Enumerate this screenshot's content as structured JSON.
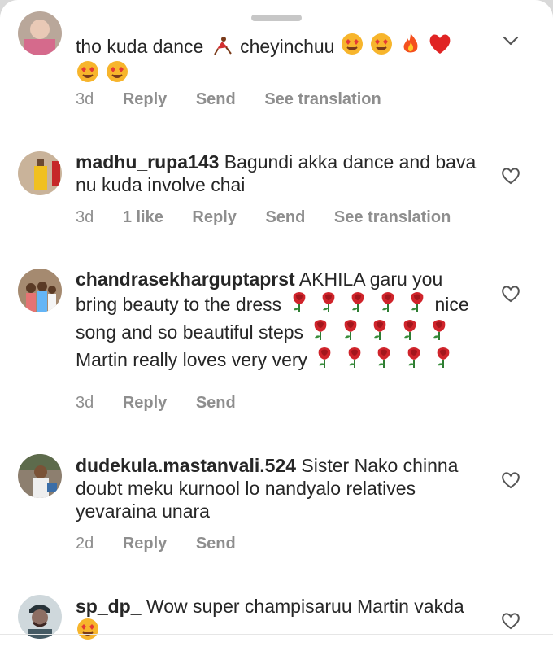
{
  "comments": [
    {
      "text_lines": [
        "tho kuda dance",
        "cheyinchuu"
      ],
      "time": "3d",
      "reply": "Reply",
      "send": "Send",
      "translate": "See translation"
    },
    {
      "username": "madhu_rupa143",
      "text": " Bagundi akka dance and bava nu kuda involve chai",
      "time": "3d",
      "likes": "1 like",
      "reply": "Reply",
      "send": "Send",
      "translate": "See translation"
    },
    {
      "username": "chandrasekharguptaprst",
      "text_parts": [
        " AKHILA garu you bring beauty to the dress ",
        "nice song and so beautiful steps",
        "Martin really loves very very"
      ],
      "time": "3d",
      "reply": "Reply",
      "send": "Send"
    },
    {
      "username": "dudekula.mastanvali.524",
      "text": " Sister Nako chinna doubt meku kurnool lo nandyalo relatives yevaraina unara",
      "time": "2d",
      "reply": "Reply",
      "send": "Send"
    },
    {
      "username": "sp_dp_",
      "text_parts": [
        " Wow super  champisaruu Martin vakda"
      ]
    }
  ],
  "icons": {
    "heart": "heart-outline-icon",
    "chevron": "chevron-down-icon",
    "emoji": [
      "dancer-emoji",
      "heart-eyes-emoji",
      "fire-emoji",
      "red-heart-emoji",
      "rose-emoji"
    ]
  },
  "colors": {
    "meta_text": "#8e8e8e",
    "body_text": "#262626",
    "rose": "#d0242b"
  }
}
